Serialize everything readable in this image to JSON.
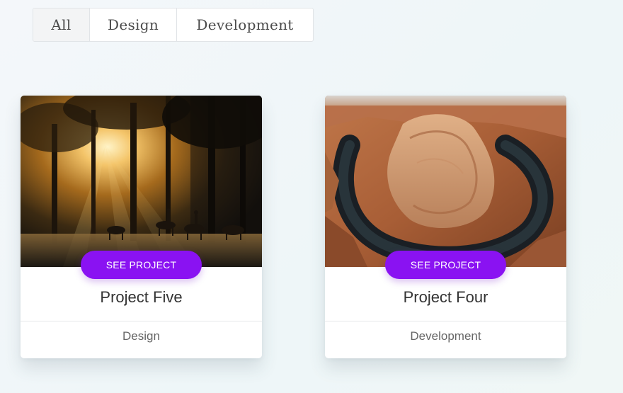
{
  "filters": {
    "items": [
      "All",
      "Design",
      "Development"
    ],
    "active": "All"
  },
  "projects": [
    {
      "image": "forest-sunrise-horses",
      "button_label": "SEE PROJECT",
      "title": "Project Five",
      "category": "Design"
    },
    {
      "image": "canyon-river-bend",
      "button_label": "SEE PROJECT",
      "title": "Project Four",
      "category": "Development"
    }
  ],
  "colors": {
    "accent": "#8a12f2",
    "background": "#f2f7f8",
    "card": "#ffffff"
  }
}
